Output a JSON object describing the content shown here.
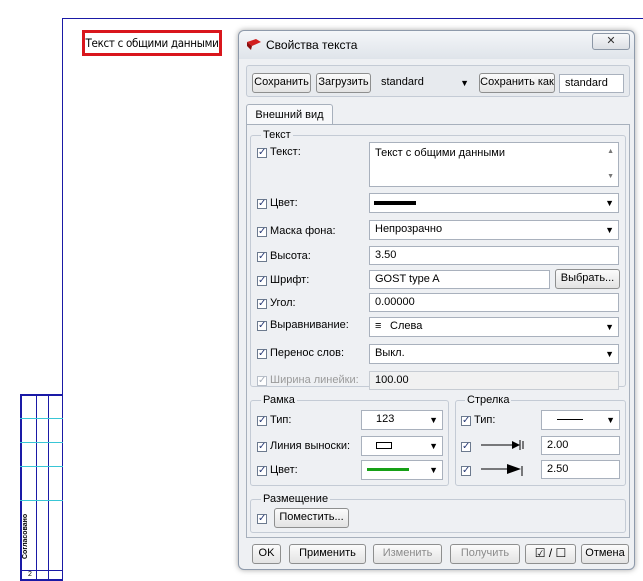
{
  "canvas": {
    "title_text": "Текст с общими данными",
    "stamp_text": "Согласовано",
    "stamp_number": "2"
  },
  "dialog": {
    "title": "Свойства текста",
    "close_glyph": "✕",
    "toolbar": {
      "save_label": "Сохранить",
      "load_label": "Загрузить",
      "style_value": "standard",
      "save_as_label": "Сохранить как",
      "save_as_value": "standard"
    },
    "tab_label": "Внешний вид",
    "text_group": {
      "title": "Текст",
      "rows": {
        "text": {
          "label": "Текст:",
          "value": "Текст с общими данными"
        },
        "color": {
          "label": "Цвет:"
        },
        "mask": {
          "label": "Маска фона:",
          "value": "Непрозрачно"
        },
        "height": {
          "label": "Высота:",
          "value": "3.50"
        },
        "font": {
          "label": "Шрифт:",
          "value": "GOST type A",
          "button": "Выбрать..."
        },
        "angle": {
          "label": "Угол:",
          "value": "0.00000"
        },
        "align": {
          "label": "Выравнивание:",
          "value": "Слева"
        },
        "wrap": {
          "label": "Перенос слов:",
          "value": "Выкл."
        },
        "line_width": {
          "label": "Ширина линейки:",
          "value": "100.00"
        }
      }
    },
    "frame_group": {
      "title": "Рамка",
      "type_label": "Тип:",
      "type_value": "123",
      "leader_label": "Линия выноски:",
      "color_label": "Цвет:",
      "color_hex": "#16a016"
    },
    "arrow_group": {
      "title": "Стрелка",
      "type_label": "Тип:",
      "size1": "2.00",
      "size2": "2.50"
    },
    "placement_group": {
      "title": "Размещение",
      "place_button": "Поместить..."
    },
    "footer": {
      "ok": "OK",
      "apply": "Применить",
      "modify": "Изменить",
      "get": "Получить",
      "toggle": "☑ / ☐",
      "cancel": "Отмена"
    }
  },
  "colors": {
    "highlight": "#d9161c",
    "sheet_border": "#1a1aa6",
    "grid": "#39c6d6"
  }
}
